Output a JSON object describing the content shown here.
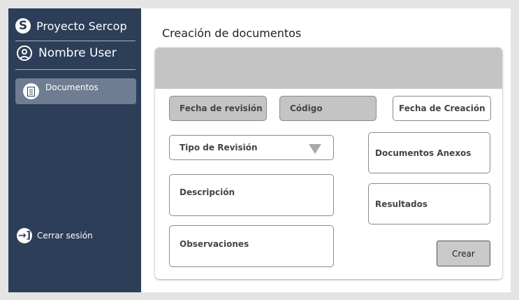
{
  "sidebar": {
    "brand_initial": "S",
    "brand_name": "Proyecto Sercop",
    "user_name": "Nombre User",
    "nav_items": [
      {
        "label": "Documentos",
        "icon": "document-icon"
      }
    ],
    "logout_label": "Cerrar sesión",
    "colors": {
      "background": "#2c3e58",
      "active_item": "#6f7d93"
    }
  },
  "main": {
    "title": "Creación de documentos",
    "form": {
      "fecha_revision": "Fecha de revisión",
      "codigo": "Código",
      "fecha_creacion": "Fecha de Creación",
      "tipo_revision": "Tipo de Revisión",
      "documentos_anexos": "Documentos Anexos",
      "descripcion": "Descripción",
      "resultados": "Resultados",
      "observaciones": "Observaciones",
      "crear_label": "Crear"
    }
  }
}
